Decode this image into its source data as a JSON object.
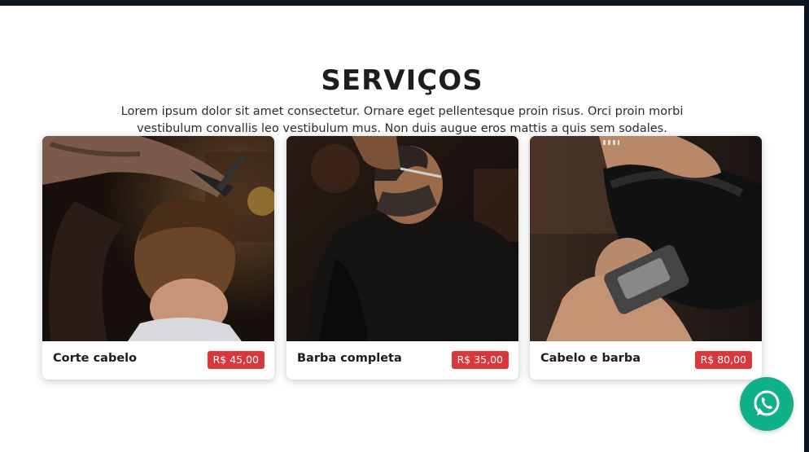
{
  "section": {
    "title": "SERVIÇOS",
    "description": "Lorem ipsum dolor sit amet consectetur. Ornare eget pellentesque proin risus. Orci proin morbi vestibulum convallis leo vestibulum mus. Non duis augue eros mattis a quis sem sodales."
  },
  "services": [
    {
      "name": "Corte cabelo",
      "price": "R$ 45,00",
      "image": "haircut-photo"
    },
    {
      "name": "Barba completa",
      "price": "R$ 35,00",
      "image": "beard-trim-photo"
    },
    {
      "name": "Cabelo e barba",
      "price": "R$ 80,00",
      "image": "hair-and-beard-photo"
    }
  ],
  "colors": {
    "accent": "#d8383c",
    "whatsapp": "#10b189",
    "frame": "#0f1a24"
  },
  "floating": {
    "icon": "whatsapp-icon"
  }
}
